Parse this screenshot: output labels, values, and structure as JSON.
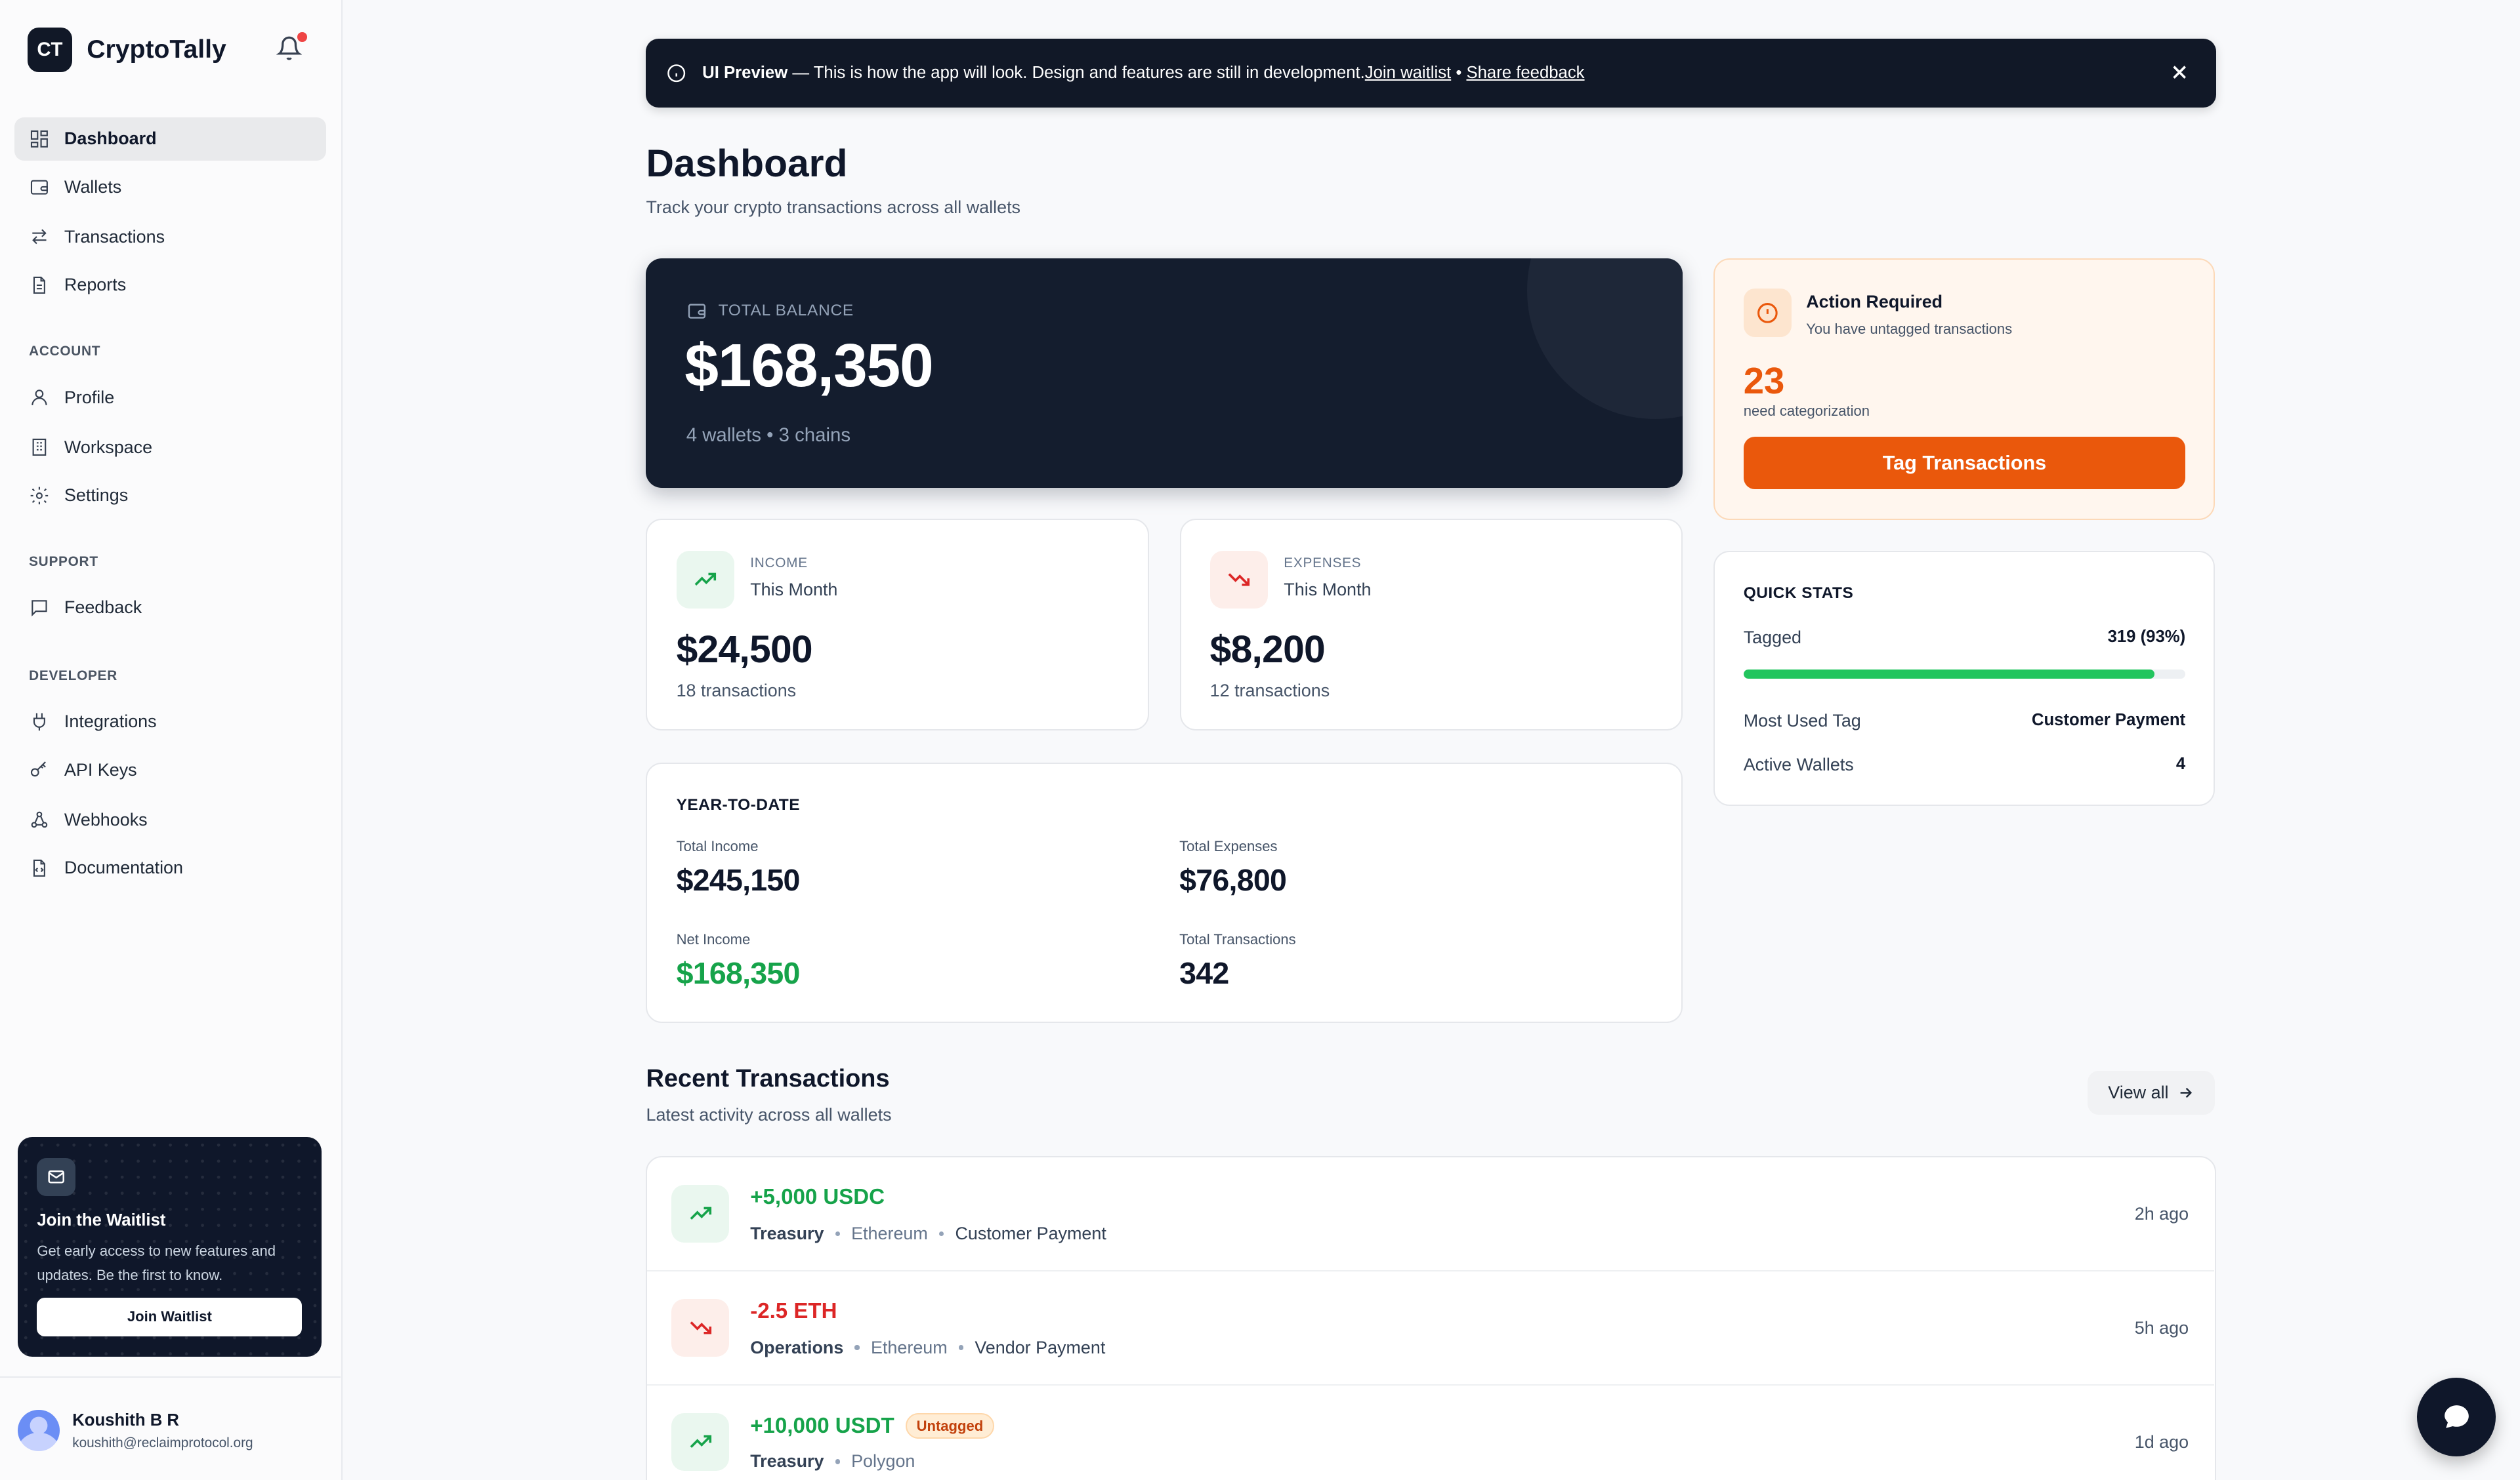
{
  "app": {
    "logo": "CT",
    "name": "CryptoTally"
  },
  "sidebar": {
    "main": [
      {
        "label": "Dashboard",
        "icon": "dashboard-icon"
      },
      {
        "label": "Wallets",
        "icon": "wallet-icon"
      },
      {
        "label": "Transactions",
        "icon": "arrows-icon"
      },
      {
        "label": "Reports",
        "icon": "document-icon"
      }
    ],
    "account_heading": "ACCOUNT",
    "account": [
      {
        "label": "Profile",
        "icon": "user-icon"
      },
      {
        "label": "Workspace",
        "icon": "building-icon"
      },
      {
        "label": "Settings",
        "icon": "gear-icon"
      }
    ],
    "support_heading": "SUPPORT",
    "support": [
      {
        "label": "Feedback",
        "icon": "message-icon"
      }
    ],
    "developer_heading": "DEVELOPER",
    "developer": [
      {
        "label": "Integrations",
        "icon": "plug-icon"
      },
      {
        "label": "API Keys",
        "icon": "key-icon"
      },
      {
        "label": "Webhooks",
        "icon": "webhook-icon"
      },
      {
        "label": "Documentation",
        "icon": "doc-code-icon"
      }
    ]
  },
  "waitlist": {
    "title": "Join the Waitlist",
    "text": "Get early access to new features and updates. Be the first to know.",
    "button": "Join Waitlist"
  },
  "user": {
    "name": "Koushith B R",
    "email": "koushith@reclaimprotocol.org"
  },
  "banner": {
    "label": "UI Preview",
    "text": " — This is how the app will look. Design and features are still in development.",
    "link1": "Join waitlist",
    "sep": " • ",
    "link2": "Share feedback"
  },
  "page": {
    "title": "Dashboard",
    "subtitle": "Track your crypto transactions across all wallets"
  },
  "balance": {
    "label": "TOTAL BALANCE",
    "value": "$168,350",
    "sub": "4 wallets • 3 chains"
  },
  "income": {
    "kind": "INCOME",
    "period": "This Month",
    "value": "$24,500",
    "count": "18 transactions"
  },
  "expenses": {
    "kind": "EXPENSES",
    "period": "This Month",
    "value": "$8,200",
    "count": "12 transactions"
  },
  "ytd": {
    "title": "YEAR-TO-DATE",
    "total_income_label": "Total Income",
    "total_income": "$245,150",
    "total_expenses_label": "Total Expenses",
    "total_expenses": "$76,800",
    "net_income_label": "Net Income",
    "net_income": "$168,350",
    "total_tx_label": "Total Transactions",
    "total_tx": "342"
  },
  "action": {
    "title": "Action Required",
    "subtitle": "You have untagged transactions",
    "count": "23",
    "count_label": "need categorization",
    "button": "Tag Transactions"
  },
  "quick_stats": {
    "title": "QUICK STATS",
    "tagged_label": "Tagged",
    "tagged_value": "319 (93%)",
    "tagged_fraction": 0.93,
    "most_used_label": "Most Used Tag",
    "most_used_value": "Customer Payment",
    "active_label": "Active Wallets",
    "active_value": "4"
  },
  "recent": {
    "title": "Recent Transactions",
    "subtitle": "Latest activity across all wallets",
    "view_all": "View all",
    "items": [
      {
        "amount": "+5,000 USDC",
        "direction": "in",
        "wallet": "Treasury",
        "chain": "Ethereum",
        "tag": "Customer Payment",
        "time": "2h ago"
      },
      {
        "amount": "-2.5 ETH",
        "direction": "out",
        "wallet": "Operations",
        "chain": "Ethereum",
        "tag": "Vendor Payment",
        "time": "5h ago"
      },
      {
        "amount": "+10,000 USDT",
        "direction": "in",
        "badge": "Untagged",
        "wallet": "Treasury",
        "chain": "Polygon",
        "time": "1d ago"
      }
    ]
  },
  "colors": {
    "accent": "#ea580c",
    "positive": "#16a34a",
    "negative": "#dc2626",
    "dark": "#111827"
  }
}
